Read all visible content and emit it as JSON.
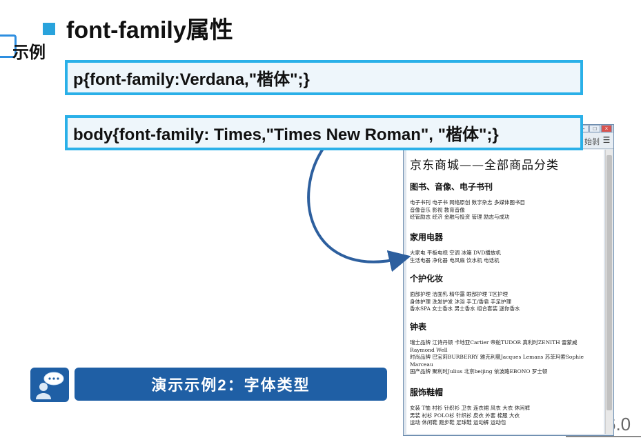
{
  "slide": {
    "title": "font-family属性",
    "sidebar_tab": "示例",
    "code_line_1": "p{font-family:Verdana,\"楷体\";}",
    "code_line_2": "body{font-family: Times,\"Times New Roman\", \"楷体\";}",
    "demo_banner": "演示示例2：字体类型",
    "slide_number": "6.0"
  },
  "browser": {
    "toolbar_text": "始剝",
    "window_controls": [
      "–",
      "□",
      "×"
    ],
    "page_heading": "京东商城——全部商品分类",
    "sections": [
      {
        "title": "图书、音像、电子书刊",
        "lines": [
          "电子书刊 电子书 网络原创 数字杂志 多媒体图书目",
          "音像音乐 影视 教育音像",
          "经管励志 经济 金融与投资 管理 励志与成功"
        ]
      },
      {
        "title": "家用电器",
        "lines": [
          "大家电 平板电视 空调 冰箱 DVD播放机",
          "生活电器 净化器 电风扇 饮水机 电话机"
        ]
      },
      {
        "title": "个护化妆",
        "lines": [
          "面部护理 洁面乳 精华露 眼部护理 T区护理",
          "身体护理 洗发护发 沐浴 手工/香皂 手足护理",
          "香水SPA 女士香水 男士香水 组合套装 迷你香水"
        ]
      },
      {
        "title": "钟表",
        "lines": [
          "瑞士品牌 江诗丹顿 卡地亚Cartier 帝舵TUDOR 真利时ZENITH 雷蒙威 Raymond Well",
          "时尚品牌 巴宝莉BURBERRY 雅克利曼Jacques Lemans 苏菲玛索Sophie Marceau",
          "国产品牌 聚利时Julius 北京beijing 依波路EBONO 罗士顿"
        ]
      },
      {
        "title": "服饰鞋帽",
        "lines": [
          "女装 T恤 衬衫 针织衫 卫衣 连衣裙 风衣 大衣 休闲裤",
          "男装 衬衫 POLO衫 针织衫 皮衣 外套 棉服 大衣",
          "运动 休闲鞋 跑步鞋 足球鞋 运动裤 运动包"
        ]
      }
    ]
  },
  "colors": {
    "accent_blue": "#29a3dc",
    "code_border": "#2ab0e8",
    "code_bg": "#eef6fb",
    "banner_blue": "#1f5fa5",
    "arrow_blue": "#2d5f9e"
  },
  "icons": [
    "title-square-icon",
    "sidebar-tab-icon",
    "curved-arrow-icon",
    "chat-person-icon",
    "menu-icon"
  ]
}
